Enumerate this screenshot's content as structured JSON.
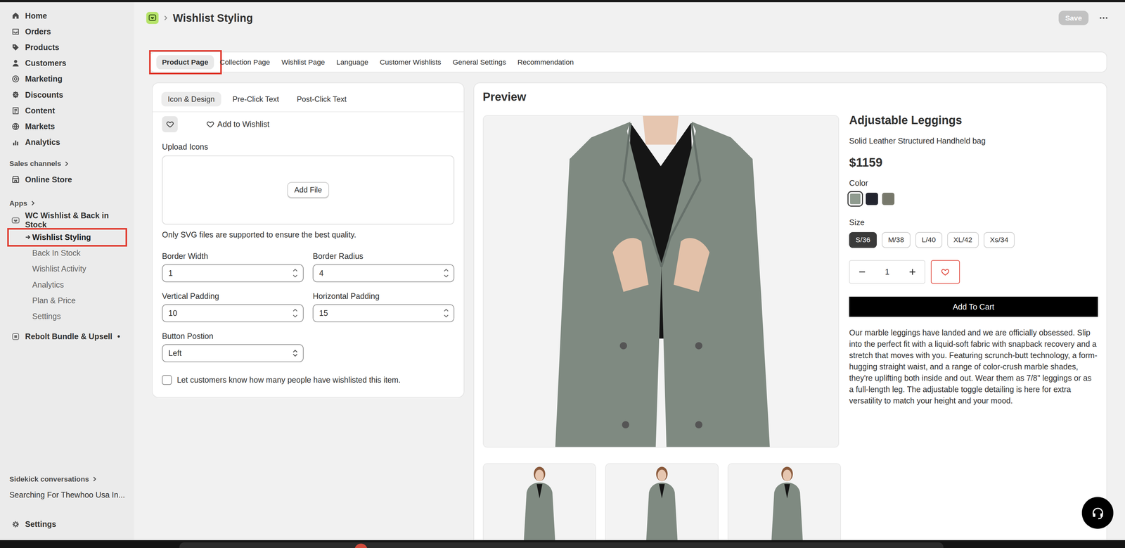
{
  "sidebar": {
    "nav": [
      {
        "label": "Home"
      },
      {
        "label": "Orders"
      },
      {
        "label": "Products"
      },
      {
        "label": "Customers"
      },
      {
        "label": "Marketing"
      },
      {
        "label": "Discounts"
      },
      {
        "label": "Content"
      },
      {
        "label": "Markets"
      },
      {
        "label": "Analytics"
      }
    ],
    "sales_channels": "Sales channels",
    "online_store": "Online Store",
    "apps_label": "Apps",
    "app": {
      "label": "WC Wishlist & Back in Stock",
      "pages": [
        {
          "label": "Wishlist Styling",
          "selected": true,
          "highlighted": true
        },
        {
          "label": "Back In Stock",
          "selected": false,
          "highlighted": false
        },
        {
          "label": "Wishlist Activity",
          "selected": false,
          "highlighted": false
        },
        {
          "label": "Analytics",
          "selected": false,
          "highlighted": false
        },
        {
          "label": "Plan & Price",
          "selected": false,
          "highlighted": false
        },
        {
          "label": "Settings",
          "selected": false,
          "highlighted": false
        }
      ]
    },
    "other_apps": [
      {
        "label": "Rebolt Bundle & Upsell",
        "badge": "•"
      }
    ],
    "sidekick": {
      "title": "Sidekick conversations",
      "items": [
        "Searching For Thewhoo Usa In..."
      ]
    },
    "settings": "Settings"
  },
  "header": {
    "title": "Wishlist Styling",
    "save": {
      "label": "Save",
      "disabled": true
    }
  },
  "tabs": [
    {
      "label": "Product Page",
      "selected": true,
      "highlighted": true
    },
    {
      "label": "Collection Page",
      "selected": false,
      "highlighted": false
    },
    {
      "label": "Wishlist Page",
      "selected": false,
      "highlighted": false
    },
    {
      "label": "Language",
      "selected": false,
      "highlighted": false
    },
    {
      "label": "Customer Wishlists",
      "selected": false,
      "highlighted": false
    },
    {
      "label": "General Settings",
      "selected": false,
      "highlighted": false
    },
    {
      "label": "Recommendation",
      "selected": false,
      "highlighted": false
    }
  ],
  "subtabs": [
    {
      "label": "Icon & Design",
      "selected": true
    },
    {
      "label": "Pre-Click Text",
      "selected": false
    },
    {
      "label": "Post-Click Text",
      "selected": false
    }
  ],
  "icon_styles": [
    {
      "kind": "icon-only",
      "selected": true
    },
    {
      "kind": "icon-text",
      "label": "Add to Wishlist",
      "selected": false
    }
  ],
  "upload": {
    "label": "Upload Icons",
    "button": "Add File",
    "hint": "Only SVG files are supported to ensure the best quality."
  },
  "fields": [
    {
      "label": "Border Width",
      "value": "1",
      "kind": "number"
    },
    {
      "label": "Border Radius",
      "value": "4",
      "kind": "number"
    },
    {
      "label": "Vertical Padding",
      "value": "10",
      "kind": "number"
    },
    {
      "label": "Horizontal Padding",
      "value": "15",
      "kind": "number"
    },
    {
      "label": "Button Postion",
      "value": "Left",
      "kind": "select"
    }
  ],
  "show_count": {
    "label": "Let customers know how many people have wishlisted this item.",
    "checked": false
  },
  "preview": {
    "title": "Preview",
    "product": {
      "name": "Adjustable Leggings",
      "subtitle": "Solid Leather Structured Handheld bag",
      "price": "$1159",
      "color_label": "Color",
      "colors": [
        {
          "color": "#8f9b8f",
          "selected": true
        },
        {
          "color": "#23252f",
          "selected": false
        },
        {
          "color": "#77786b",
          "selected": false
        }
      ],
      "size_label": "Size",
      "sizes": [
        {
          "label": "S/36",
          "selected": true
        },
        {
          "label": "M/38",
          "selected": false
        },
        {
          "label": "L/40",
          "selected": false
        },
        {
          "label": "XL/42",
          "selected": false
        },
        {
          "label": "Xs/34",
          "selected": false
        }
      ],
      "quantity": "1",
      "wishlisted": false,
      "add_to_cart": "Add To Cart",
      "description": "Our marble leggings have landed and we are officially obsessed. Slip into the perfect fit with a liquid-soft fabric with snapback recovery and a stretch that moves with you. Featuring scrunch-butt technology, a form-hugging straight waist, and a range of color-crush marble shades, they're uplifting both inside and out. Wear them as 7/8\" leggings or as a full-length leg. The adjustable toggle detailing is here for extra versatility to match your height and your mood."
    }
  }
}
